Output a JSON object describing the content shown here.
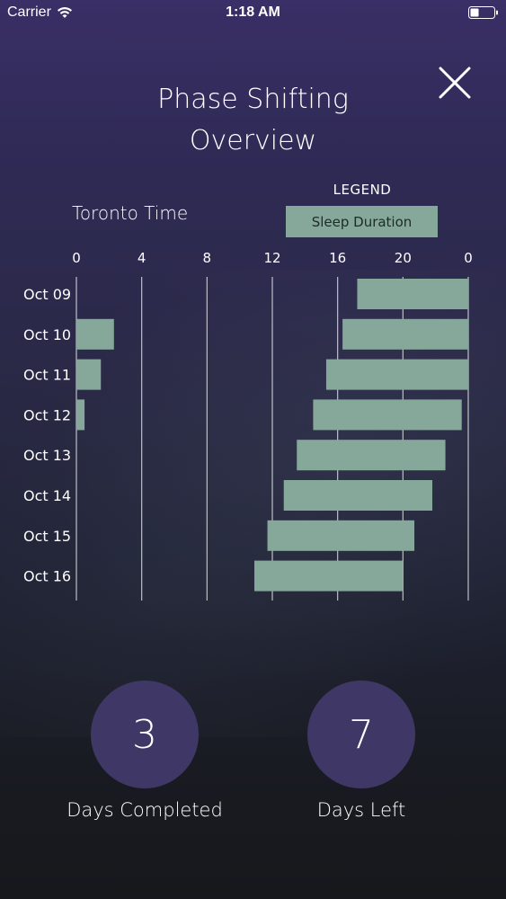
{
  "status_bar": {
    "carrier": "Carrier",
    "time": "1:18 AM"
  },
  "header": {
    "title_line1": "Phase Shifting",
    "title_line2": "Overview"
  },
  "legend": {
    "heading": "LEGEND",
    "sleep_duration_label": "Sleep Duration",
    "sleep_color": "#86a89a"
  },
  "timezone_label": "Toronto Time",
  "chart_data": {
    "type": "bar",
    "orientation": "horizontal-range",
    "x_ticks": [
      "0",
      "4",
      "8",
      "12",
      "16",
      "20",
      "0"
    ],
    "xlim": [
      0,
      24
    ],
    "grid": true,
    "categories": [
      "Oct 09",
      "Oct 10",
      "Oct 11",
      "Oct 12",
      "Oct 13",
      "Oct 14",
      "Oct 15",
      "Oct 16"
    ],
    "series": [
      {
        "name": "Sleep Duration",
        "segments": [
          [
            [
              17.2,
              24
            ]
          ],
          [
            [
              0,
              2.3
            ],
            [
              16.3,
              24
            ]
          ],
          [
            [
              0,
              1.5
            ],
            [
              15.3,
              24
            ]
          ],
          [
            [
              0,
              0.5
            ],
            [
              14.5,
              23.6
            ]
          ],
          [
            [
              13.5,
              22.6
            ]
          ],
          [
            [
              12.7,
              21.8
            ]
          ],
          [
            [
              11.7,
              20.7
            ]
          ],
          [
            [
              10.9,
              20.0
            ]
          ]
        ]
      }
    ]
  },
  "stats": {
    "days_completed_value": "3",
    "days_completed_label": "Days Completed",
    "days_left_value": "7",
    "days_left_label": "Days Left"
  }
}
